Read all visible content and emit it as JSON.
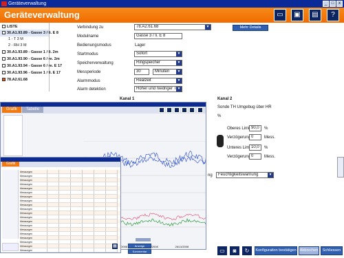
{
  "window": {
    "title": "Geräteverwaltung"
  },
  "header": {
    "title": "Geräteverwaltung",
    "buttons": [
      "folder-icon",
      "save-icon",
      "print-icon",
      "help-icon"
    ]
  },
  "sidebar": {
    "title": "LISTE",
    "items": [
      {
        "label": "30.A1.93.89 - Gasse 3 / li. E 8",
        "selected": true
      },
      {
        "label": "1 - T  3 M",
        "sub": true
      },
      {
        "label": "2 - RH 3 M",
        "sub": true
      },
      {
        "label": "30.A1.93.89 - Gasse 1 / li. 2m"
      },
      {
        "label": "30.A1.93.90 - Gasse 6 / re. 2m"
      },
      {
        "label": "30.A1.93.94 - Gasse 6 / re. E 17"
      },
      {
        "label": "30.A1.93.96 - Gasse 1 / li. E 17"
      },
      {
        "label": "78.A2.61.68"
      }
    ]
  },
  "form": {
    "verbindung_label": "Verbindung zu",
    "verbindung_value": "78.A2.61.68",
    "modulname_label": "Modulname",
    "modulname_value": "Gasse 3 / li.  E 8",
    "betriebsmodus_label": "Bedienungsmodus",
    "betriebsmodus_value": "Lager",
    "startmodus_label": "Startmodus",
    "startmodus_value": "Sofort",
    "speicher_label": "Speicherverwaltung",
    "speicher_value": "Ringspeicher",
    "messperiode_label": "Messperiode",
    "messperiode_value": "30",
    "messperiode_unit": "Minuten",
    "alarmmodus_label": "Alarmmodus",
    "alarmmodus_value": "Realzeit",
    "alarmdetektion_label": "Alarm detektion",
    "alarmdetektion_value": "Höher und niedriger Ten",
    "details_button": "Mehr Details"
  },
  "kanal1": {
    "title": "Kanal 1"
  },
  "kanal2": {
    "title": "Kanal 2",
    "desc": "Sonde TH Umgebug über HR",
    "unit": "%",
    "oberes_label": "Oberes Limit",
    "oberes_value": "90,0",
    "oberes_unit": "%",
    "verz1_label": "Verzögerung",
    "verz1_value": "0",
    "verz1_unit": "Mess.",
    "unteres_label": "Unteres Limit",
    "unteres_value": "10,0",
    "unteres_unit": "%",
    "verz2_label": "Verzögerung",
    "verz2_value": "0",
    "verz2_unit": "Mess.",
    "warn_suffix": "ng",
    "warn_value": "Feuchtigkeitswarnung"
  },
  "graph_window": {
    "tabs": [
      "Grafik",
      "Tabelle"
    ],
    "x_ticks": [
      "28/11/2008",
      "12/11/2008",
      "19/11/2008",
      "26/11/2008"
    ]
  },
  "table_window": {
    "tabs": [
      "Grafik"
    ],
    "buttons": [
      "Anzeige speichern",
      "Kommentar"
    ],
    "row_label": "Messungen",
    "row_count": 24
  },
  "footer": {
    "config_button": "Konfiguration bestätigen",
    "abbrechen_button": "Abbrechen",
    "schliessen_button": "Schliessen"
  },
  "colors": {
    "orange": "#f26b00",
    "navy": "#0c2560",
    "blue_line": "#3a5bd0",
    "pink_line": "#e05a7a",
    "green_line": "#2a9a3a"
  }
}
